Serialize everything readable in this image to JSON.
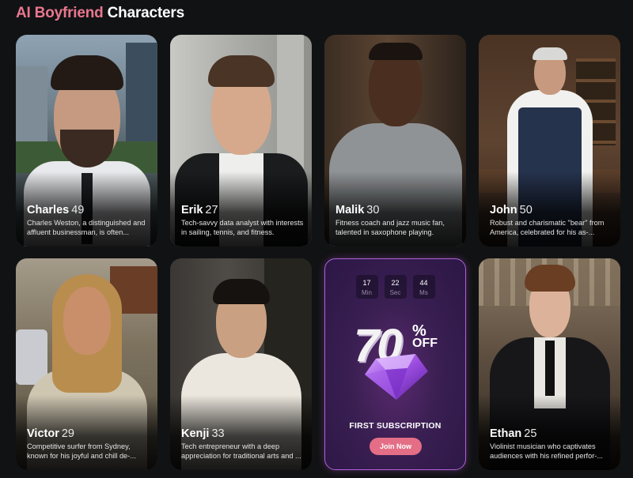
{
  "header": {
    "title_accent": "AI Boyfriend",
    "title_rest": "Characters"
  },
  "cards": [
    {
      "name": "Charles",
      "age": "49",
      "desc": "Charles Weston, a distinguished and affluent businessman, is often..."
    },
    {
      "name": "Erik",
      "age": "27",
      "desc": "Tech-savvy data analyst with interests in sailing, tennis, and fitness."
    },
    {
      "name": "Malik",
      "age": "30",
      "desc": "Fitness coach and jazz music fan, talented in saxophone playing."
    },
    {
      "name": "John",
      "age": "50",
      "desc": "Robust and charismatic \"bear\" from America, celebrated for his as-..."
    },
    {
      "name": "Victor",
      "age": "29",
      "desc": "Competitive surfer from Sydney, known for his joyful and chill de-..."
    },
    {
      "name": "Kenji",
      "age": "33",
      "desc": "Tech entrepreneur with a deep appreciation for traditional arts and ..."
    },
    {
      "name": "Ethan",
      "age": "25",
      "desc": "Violinist musician who captivates audiences with his refined perfor-..."
    }
  ],
  "promo": {
    "timer": [
      {
        "value": "17",
        "unit": "Min"
      },
      {
        "value": "22",
        "unit": "Sec"
      },
      {
        "value": "44",
        "unit": "Ms"
      }
    ],
    "discount": "70",
    "percent_sign": "%",
    "off_label": "OFF",
    "subtitle": "FIRST SUBSCRIPTION",
    "cta": "Join Now"
  },
  "colors": {
    "accent": "#e8778f",
    "button": "#e36e86",
    "promo_border": "#b062d6"
  }
}
